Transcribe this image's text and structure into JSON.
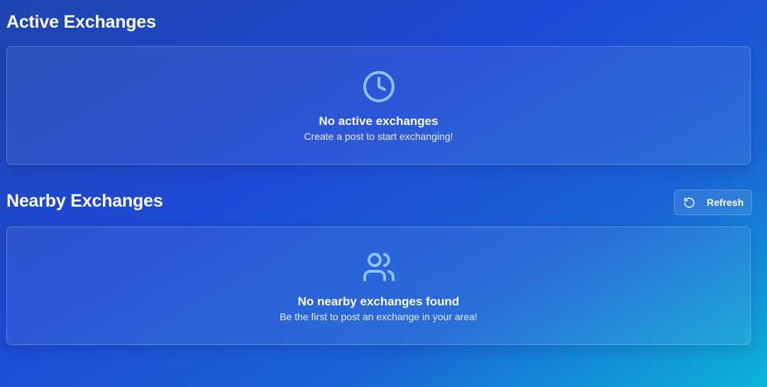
{
  "active_section": {
    "title": "Active Exchanges",
    "icon": "clock-icon",
    "empty_title": "No active exchanges",
    "empty_subtitle": "Create a post to start exchanging!"
  },
  "nearby_section": {
    "title": "Nearby Exchanges",
    "refresh_label": "Refresh",
    "refresh_icon": "refresh-icon",
    "icon": "users-icon",
    "empty_title": "No nearby exchanges found",
    "empty_subtitle": "Be the first to post an exchange in your area!"
  },
  "colors": {
    "accent_icon": "#8ec2ff",
    "text": "#ffffff"
  }
}
